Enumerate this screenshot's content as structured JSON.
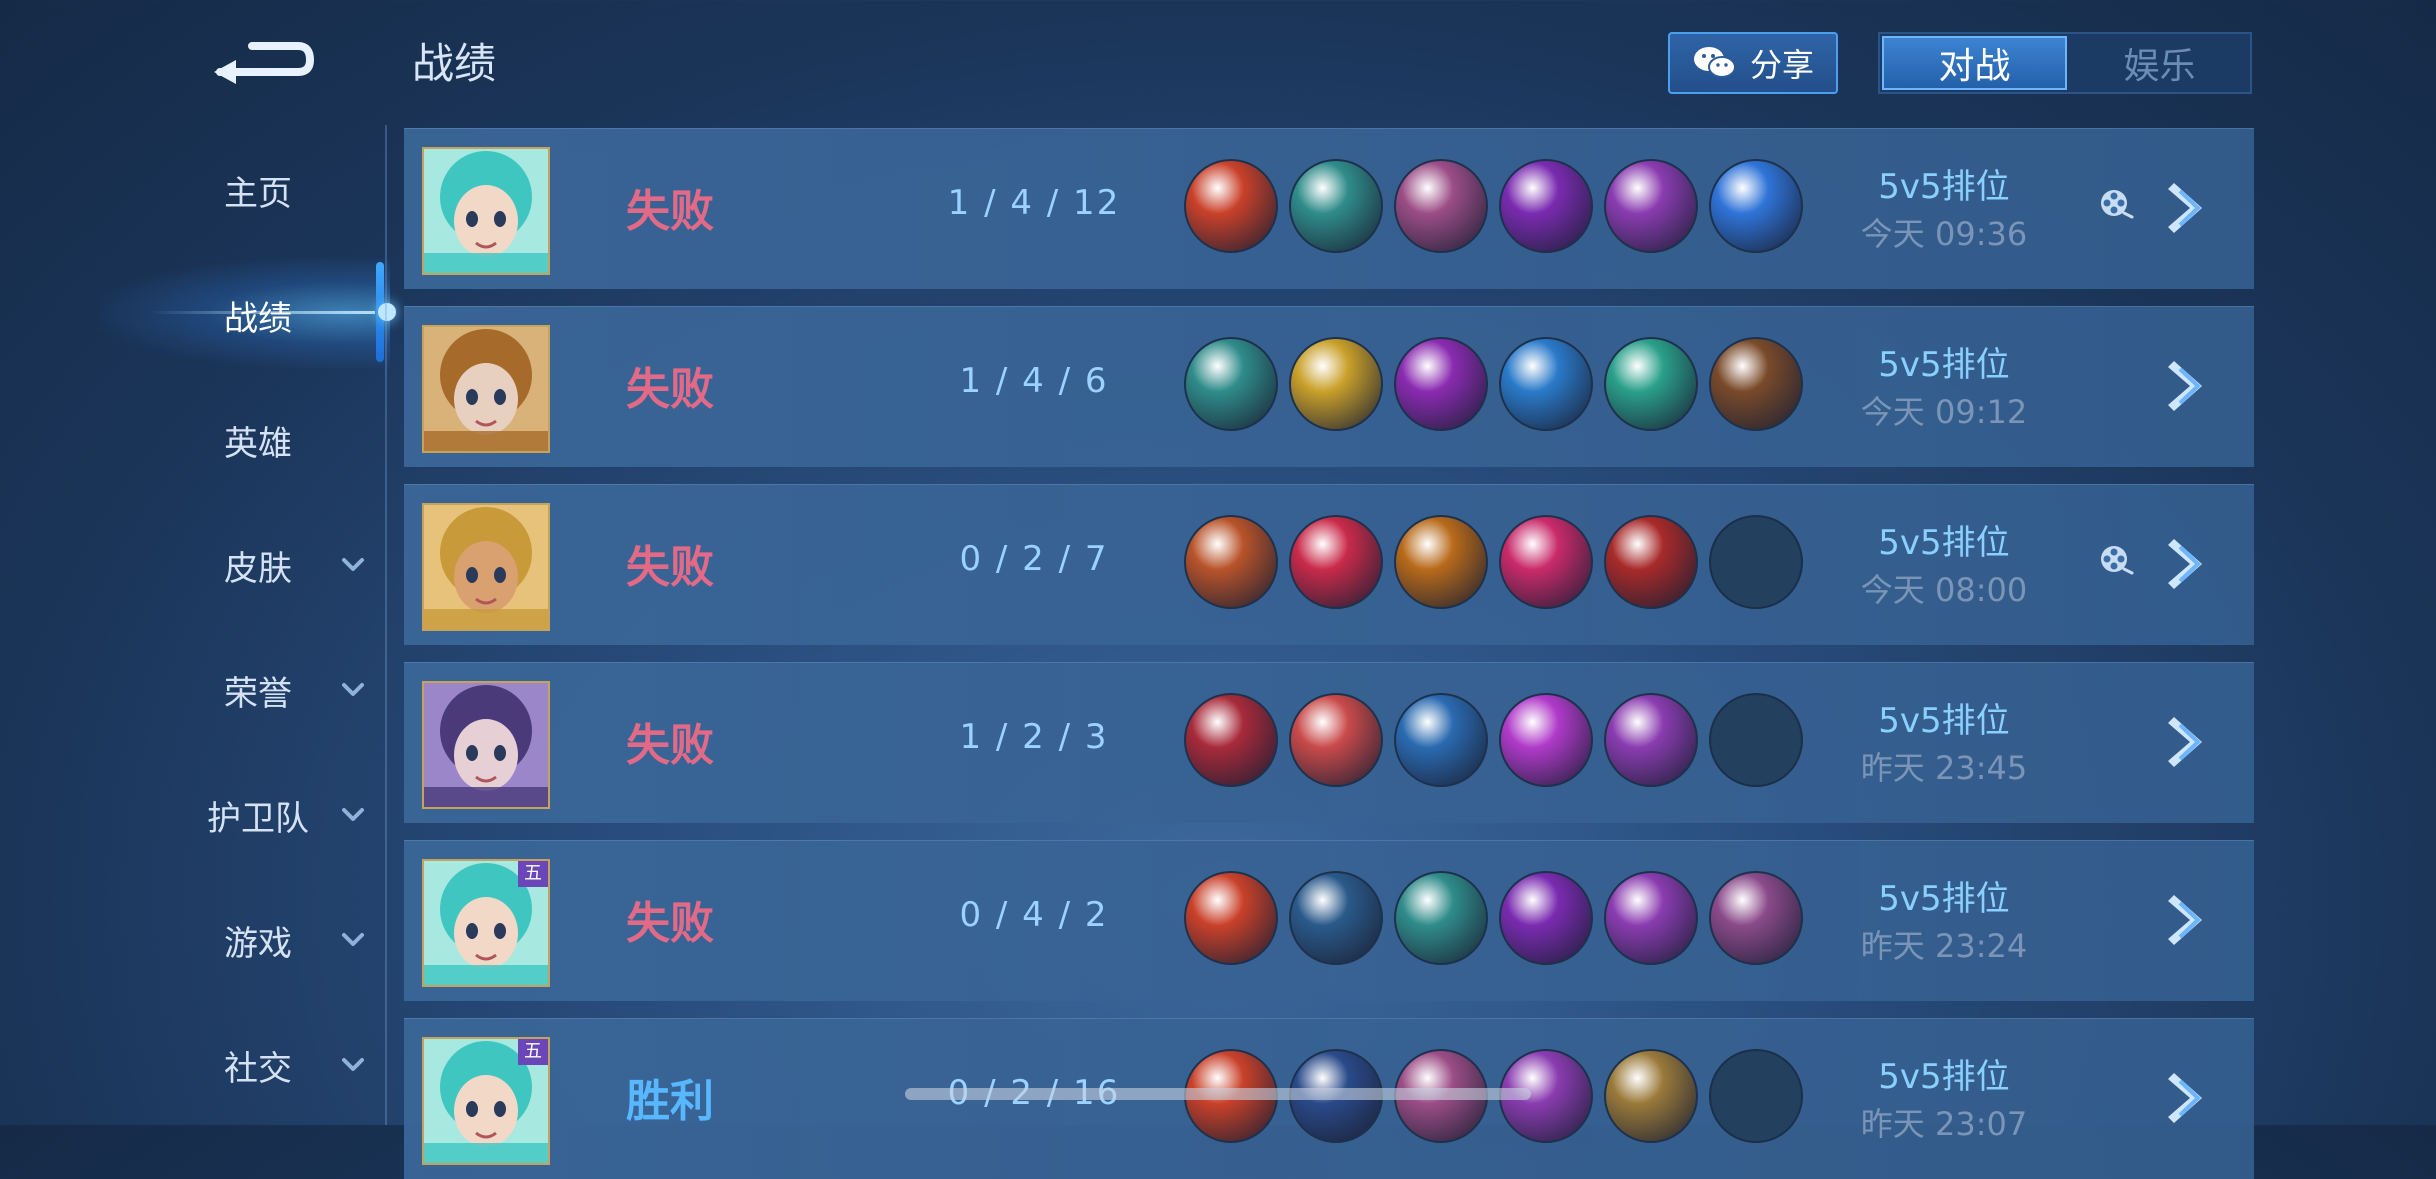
{
  "app": {
    "page_title": "战绩"
  },
  "header": {
    "share_label": "分享",
    "tabs": [
      {
        "label": "对战",
        "active": true
      },
      {
        "label": "娱乐",
        "active": false
      }
    ]
  },
  "sidebar": {
    "items": [
      {
        "label": "主页",
        "active": false,
        "expandable": false
      },
      {
        "label": "战绩",
        "active": true,
        "expandable": false
      },
      {
        "label": "英雄",
        "active": false,
        "expandable": false
      },
      {
        "label": "皮肤",
        "active": false,
        "expandable": true
      },
      {
        "label": "荣誉",
        "active": false,
        "expandable": true
      },
      {
        "label": "护卫队",
        "active": false,
        "expandable": true
      },
      {
        "label": "游戏",
        "active": false,
        "expandable": true
      },
      {
        "label": "社交",
        "active": false,
        "expandable": true
      }
    ]
  },
  "matches": [
    {
      "result": "失败",
      "outcome": "lose",
      "kda": "1 / 4 / 12",
      "mode": "5v5排位",
      "time": "今天 09:36",
      "replay": true,
      "avatar_badge": "",
      "items": [
        "#c9412a",
        "#2f8c8a",
        "#9b4d86",
        "#7a2bb0",
        "#8a3cb0",
        "#2f74d8"
      ]
    },
    {
      "result": "失败",
      "outcome": "lose",
      "kda": "1 / 4 / 6",
      "mode": "5v5排位",
      "time": "今天 09:12",
      "replay": false,
      "avatar_badge": "",
      "items": [
        "#2f8c8a",
        "#c9a02a",
        "#8a2bb0",
        "#2a7ac9",
        "#2aa08a",
        "#7a4a2a"
      ]
    },
    {
      "result": "失败",
      "outcome": "lose",
      "kda": "0 / 2 / 7",
      "mode": "5v5排位",
      "time": "今天 08:00",
      "replay": true,
      "avatar_badge": "",
      "items": [
        "#b8532a",
        "#c92a4a",
        "#b86a1a",
        "#c92a6a",
        "#a82a2a",
        ""
      ]
    },
    {
      "result": "失败",
      "outcome": "lose",
      "kda": "1 / 2 / 3",
      "mode": "5v5排位",
      "time": "昨天 23:45",
      "replay": false,
      "avatar_badge": "",
      "items": [
        "#a82a3a",
        "#c94a4a",
        "#2a6ab0",
        "#b03ac9",
        "#8a3cb0",
        ""
      ]
    },
    {
      "result": "失败",
      "outcome": "lose",
      "kda": "0 / 4 / 2",
      "mode": "5v5排位",
      "time": "昨天 23:24",
      "replay": false,
      "avatar_badge": "五",
      "items": [
        "#c9412a",
        "#2a5a8a",
        "#2f8c8a",
        "#7a2bb0",
        "#8a3cb0",
        "#8a4a8a"
      ]
    },
    {
      "result": "胜利",
      "outcome": "win",
      "kda": "0 / 2 / 16",
      "mode": "5v5排位",
      "time": "昨天 23:07",
      "replay": false,
      "avatar_badge": "五",
      "items": [
        "#c9412a",
        "#2a4a8a",
        "#9b4d86",
        "#8a3cb0",
        "#9a7a3a",
        ""
      ]
    }
  ],
  "icons": {
    "back": "back-arrow-icon",
    "share": "wechat-icon",
    "replay": "film-reel-icon",
    "detail": "chevron-right-icon"
  },
  "colors": {
    "lose": "#e26a87",
    "win": "#58b7ff",
    "accent": "#3c84d2"
  }
}
